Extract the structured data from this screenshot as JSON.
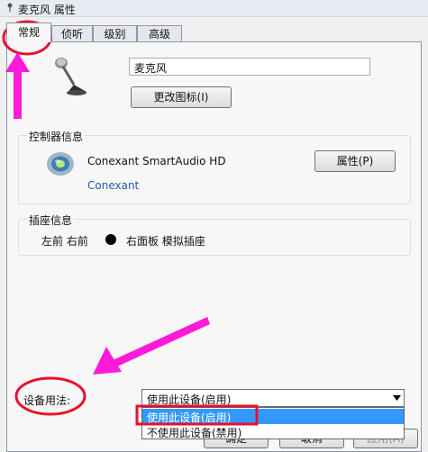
{
  "window": {
    "title": "麦克风 属性"
  },
  "tabs": [
    {
      "label": "常规",
      "active": true
    },
    {
      "label": "侦听",
      "active": false
    },
    {
      "label": "级别",
      "active": false
    },
    {
      "label": "高级",
      "active": false
    }
  ],
  "device": {
    "name": "麦克风",
    "icon": "microphone-icon",
    "change_icon_label": "更改图标(I)"
  },
  "controller": {
    "group_label": "控制器信息",
    "name": "Conexant SmartAudio HD",
    "vendor_link": "Conexant",
    "properties_label": "属性(P)",
    "icon": "audio-controller-icon"
  },
  "jack": {
    "group_label": "插座信息",
    "text_left": "左前 右前",
    "text_right": "右面板 模拟插座",
    "jack_color": "#000000"
  },
  "usage": {
    "label": "设备用法:",
    "selected": "使用此设备(启用)",
    "options": [
      "使用此设备(启用)",
      "不使用此设备(禁用)"
    ]
  },
  "footer": {
    "ok_label": "确定",
    "cancel_label": "取消",
    "apply_label": "应用(A)"
  },
  "annotations": {
    "color": "#ff1ad9",
    "highlight_color": "#e8112d"
  }
}
